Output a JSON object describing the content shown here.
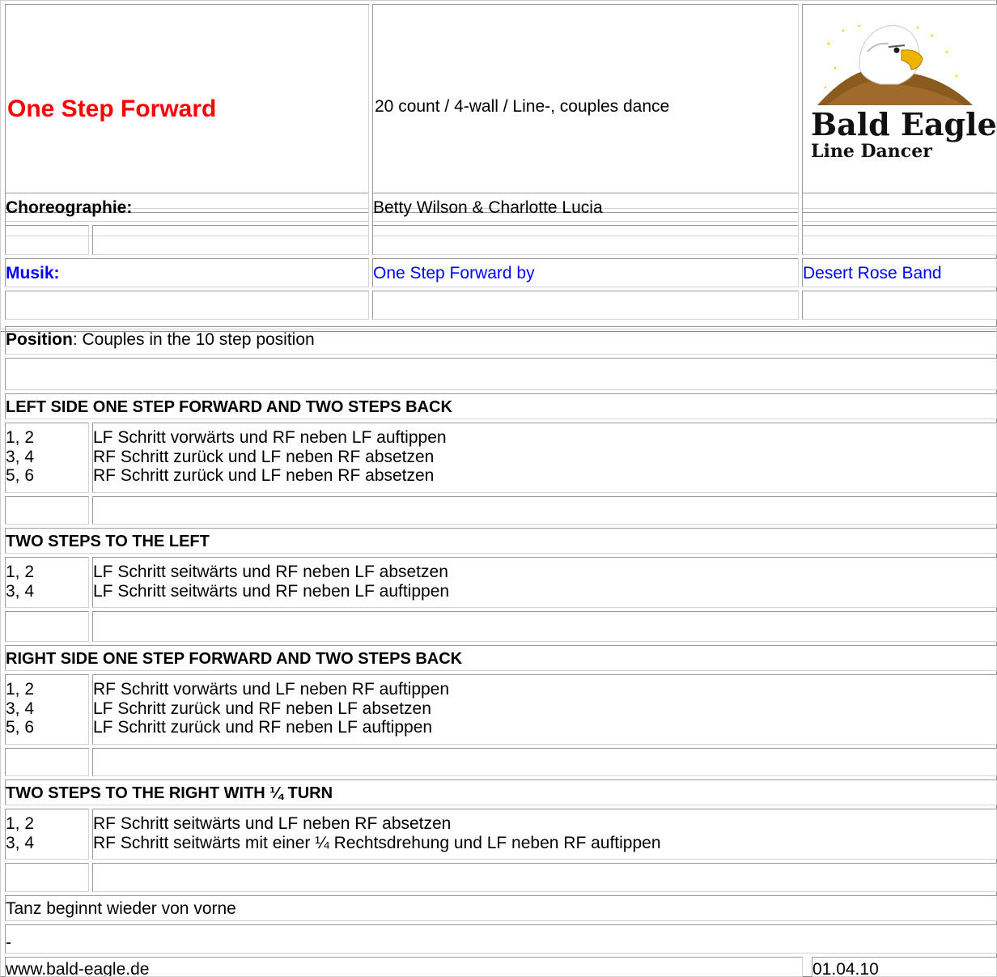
{
  "header": {
    "title": "One Step Forward",
    "info": "20 count / 4-wall / Line-, couples dance",
    "logo": {
      "line1": "Bald Eagle",
      "line2": "Line Dancer",
      "icon": "eagle-head-icon"
    }
  },
  "choreography": {
    "label": "Choreographie:",
    "value": "Betty Wilson & Charlotte Lucia"
  },
  "music": {
    "label": "Musik:",
    "title": "One Step Forward by",
    "artist": "Desert Rose Band"
  },
  "position": {
    "label": "Position",
    "text": ": Couples in the 10 step position"
  },
  "sections": [
    {
      "heading": "LEFT SIDE ONE STEP FORWARD AND TWO STEPS BACK",
      "counts": "1, 2\n3, 4\n5, 6",
      "steps": "LF Schritt vorwärts und RF neben LF auftippen\nRF Schritt zurück und LF neben RF absetzen\nRF Schritt zurück und LF neben RF absetzen"
    },
    {
      "heading": "TWO STEPS TO THE LEFT",
      "counts": "1, 2\n3, 4",
      "steps": "LF Schritt seitwärts und RF neben LF absetzen\nLF Schritt seitwärts und RF neben LF auftippen"
    },
    {
      "heading": "RIGHT SIDE ONE STEP FORWARD AND TWO STEPS BACK",
      "counts": "1, 2\n3, 4\n5, 6",
      "steps": "RF Schritt vorwärts und LF neben RF auftippen\nLF Schritt zurück und RF neben LF absetzen\nLF Schritt zurück und RF neben LF auftippen"
    },
    {
      "heading": "TWO STEPS TO THE RIGHT WITH ¼ TURN",
      "counts": "1, 2\n3, 4",
      "steps": "RF Schritt seitwärts und LF neben RF absetzen\nRF Schritt seitwärts mit einer ¼ Rechtsdrehung und LF neben RF auftippen"
    }
  ],
  "ending": "Tanz beginnt wieder von vorne",
  "dash": "-",
  "footer": {
    "website": "www.bald-eagle.de",
    "date": "01.04.10"
  }
}
